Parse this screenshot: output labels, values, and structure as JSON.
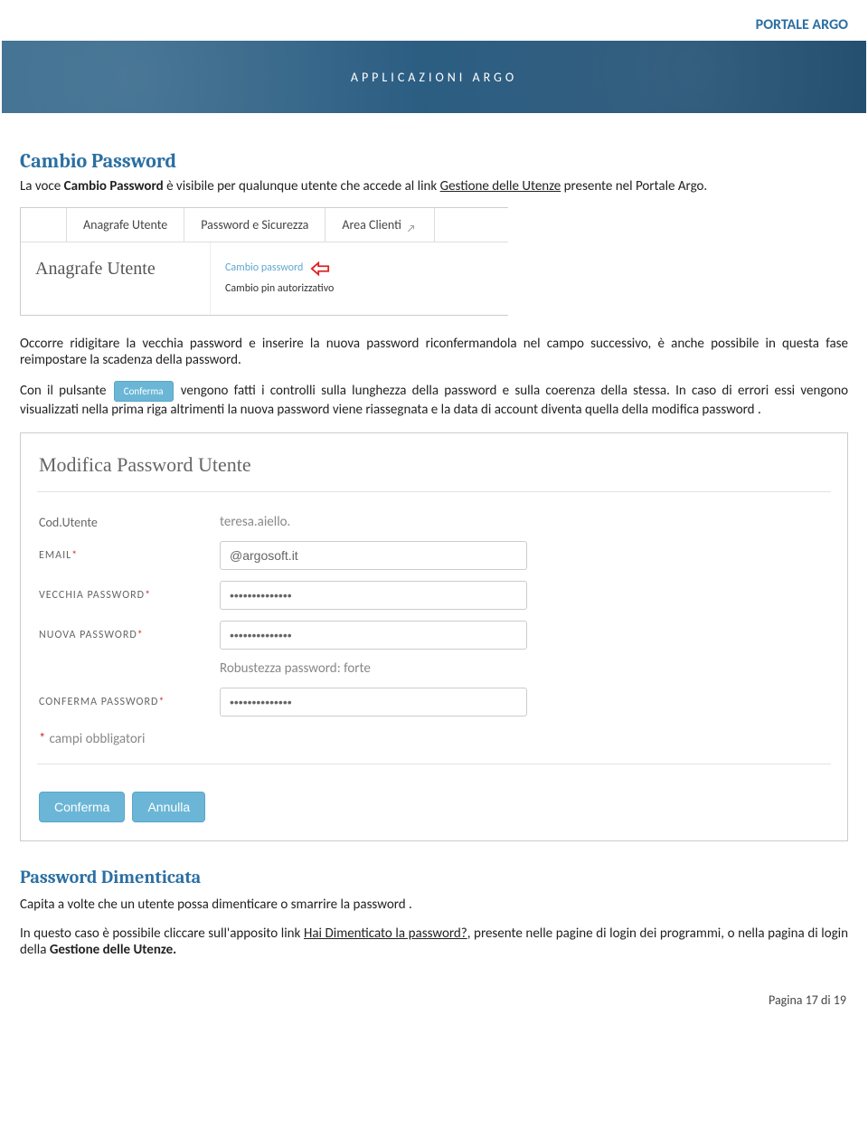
{
  "header": {
    "portal": "PORTALE ARGO"
  },
  "banner": {
    "text": "APPLICAZIONI ARGO"
  },
  "section1": {
    "title": "Cambio Password",
    "intro_pre": "La voce ",
    "intro_bold": "Cambio Password",
    "intro_mid": " è visibile per qualunque utente che accede al link  ",
    "intro_link": "Gestione delle Utenze",
    "intro_post": " presente nel Portale Argo."
  },
  "tabsShot": {
    "tabs": [
      "Anagrafe Utente",
      "Password e Sicurezza",
      "Area Clienti"
    ],
    "leftTitle": "Anagrafe Utente",
    "submenu": [
      "Cambio password",
      "Cambio pin autorizzativo"
    ]
  },
  "para2": "Occorre ridigitare la vecchia password e inserire la nuova password riconfermandola nel campo successivo, è anche possibile in questa fase reimpostare la scadenza della password.",
  "para3": {
    "pre": "Con il pulsante ",
    "btn": "Conferma",
    "post": " vengono fatti i controlli sulla lunghezza della password e sulla coerenza della stessa. In caso di errori essi vengono visualizzati nella prima riga altrimenti la nuova password viene riassegnata e la data di account diventa quella della modifica password ."
  },
  "form": {
    "title": "Modifica Password Utente",
    "labels": {
      "cod": "Cod.Utente",
      "email": "EMAIL",
      "old": "VECCHIA PASSWORD",
      "new": "NUOVA PASSWORD",
      "confirm": "CONFERMA PASSWORD"
    },
    "values": {
      "cod": "teresa.aiello.",
      "email": "@argosoft.it",
      "old": "••••••••••••••",
      "new": "••••••••••••••",
      "confirm": "••••••••••••••"
    },
    "strength": "Robustezza password: forte",
    "required_note": "campi obbligatori",
    "btn_confirm": "Conferma",
    "btn_cancel": "Annulla"
  },
  "section2": {
    "title": "Password Dimenticata",
    "p1": "Capita a volte che un utente possa dimenticare o smarrire la password .",
    "p2_pre": "In questo caso è possibile cliccare sull'apposito link ",
    "p2_link": "Hai Dimenticato la password?",
    "p2_mid": ", presente nelle pagine di login dei programmi, o nella pagina di login della ",
    "p2_bold": "Gestione delle Utenze."
  },
  "footer": {
    "prefix": "Pagina ",
    "cur": "17",
    "sep": " di ",
    "total": "19"
  }
}
